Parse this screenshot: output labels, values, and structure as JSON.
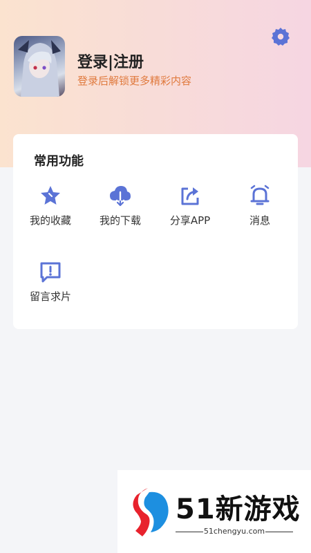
{
  "profile": {
    "login_label": "登录|注册",
    "login_subtitle": "登录后解锁更多精彩内容",
    "settings_icon": "gear-icon"
  },
  "features": {
    "section_title": "常用功能",
    "items": [
      {
        "label": "我的收藏",
        "icon": "star-icon"
      },
      {
        "label": "我的下载",
        "icon": "cloud-download-icon"
      },
      {
        "label": "分享APP",
        "icon": "share-icon"
      },
      {
        "label": "消息",
        "icon": "bell-icon"
      },
      {
        "label": "留言求片",
        "icon": "message-alert-icon"
      }
    ]
  },
  "watermark": {
    "brand": "51新游戏",
    "url": "51chengyu.com"
  },
  "colors": {
    "accent": "#5b73d6",
    "subtitle": "#e07a3e"
  }
}
